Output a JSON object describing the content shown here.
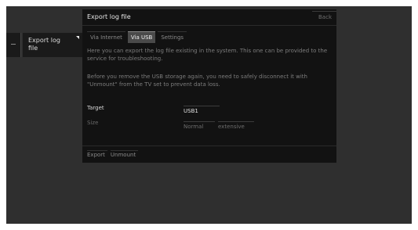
{
  "side_menu": {
    "item_label": "Export log file"
  },
  "dialog": {
    "title": "Export log file",
    "back_label": "Back",
    "tabs": [
      {
        "label": "Via Internet",
        "active": false
      },
      {
        "label": "Via USB",
        "active": true
      },
      {
        "label": "Settings",
        "active": false
      }
    ],
    "paragraph1": "Here you can export the log file existing in the system. This one can be provided to the service for troubleshooting.",
    "paragraph2": "Before you remove the USB storage again, you need to safely disconnect it with \"Unmount\" from the TV set to prevent data loss.",
    "target_label": "Target",
    "target_value": "USB1",
    "size_label": "Size",
    "size_options": [
      "Normal",
      "extensive"
    ],
    "buttons": [
      "Export",
      "Unmount"
    ]
  },
  "colors": {
    "screen_bg": "#2f2f2f",
    "dialog_bg": "#121212",
    "active_tab_bg": "#4a4a4a"
  }
}
